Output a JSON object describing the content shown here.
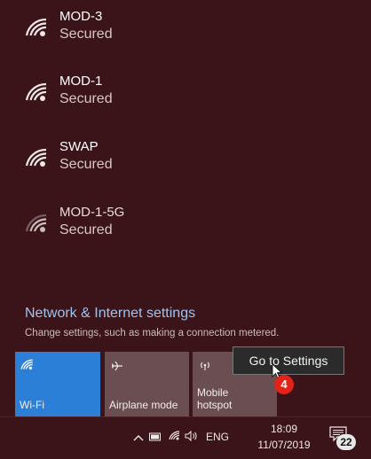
{
  "networks": [
    {
      "name": "MOD-3",
      "status": "Secured"
    },
    {
      "name": "MOD-1",
      "status": "Secured"
    },
    {
      "name": "SWAP",
      "status": "Secured"
    },
    {
      "name": "MOD-1-5G",
      "status": "Secured"
    }
  ],
  "settings": {
    "link": "Network & Internet settings",
    "description": "Change settings, such as making a connection metered."
  },
  "tiles": {
    "wifi": {
      "label": "Wi-Fi",
      "active": true
    },
    "airplane": {
      "label": "Airplane mode",
      "active": false
    },
    "hotspot": {
      "label": "Mobile\nhotspot",
      "label_line1": "Mobile",
      "label_line2": "hotspot",
      "active": false
    }
  },
  "tooltip": {
    "text": "Go to Settings"
  },
  "step_badge": {
    "number": "4"
  },
  "taskbar": {
    "language": "ENG",
    "time": "18:09",
    "date": "11/07/2019",
    "notifications_count": "22",
    "icons": [
      "chevron-up-icon",
      "battery-icon",
      "wifi-icon",
      "volume-icon"
    ]
  },
  "colors": {
    "panel_bg": "#3b1419",
    "active_tile": "#2b7fd6",
    "inactive_tile": "#6b4e51",
    "link": "#9fc3ee",
    "badge": "#e2231a"
  }
}
